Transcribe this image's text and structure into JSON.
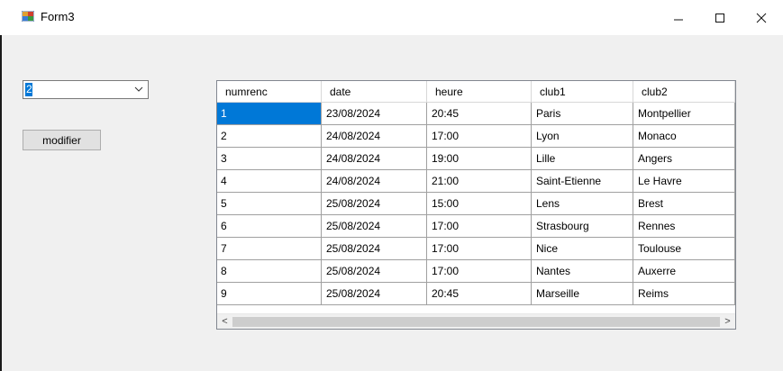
{
  "window": {
    "title": "Form3",
    "icon": "winforms-app-icon",
    "minimize_glyph": "—",
    "maximize_glyph": "☐",
    "close_glyph": "✕"
  },
  "combo": {
    "selected_value": "2",
    "arrow_icon": "chevron-down-icon"
  },
  "buttons": {
    "modifier_label": "modifier"
  },
  "grid": {
    "columns": [
      "numrenc",
      "date",
      "heure",
      "club1",
      "club2"
    ],
    "selected_row": 0,
    "rows": [
      [
        "1",
        "23/08/2024",
        "20:45",
        "Paris",
        "Montpellier"
      ],
      [
        "2",
        "24/08/2024",
        "17:00",
        "Lyon",
        "Monaco"
      ],
      [
        "3",
        "24/08/2024",
        "19:00",
        "Lille",
        "Angers"
      ],
      [
        "4",
        "24/08/2024",
        "21:00",
        "Saint-Etienne",
        "Le Havre"
      ],
      [
        "5",
        "25/08/2024",
        "15:00",
        "Lens",
        "Brest"
      ],
      [
        "6",
        "25/08/2024",
        "17:00",
        "Strasbourg",
        "Rennes"
      ],
      [
        "7",
        "25/08/2024",
        "17:00",
        "Nice",
        "Toulouse"
      ],
      [
        "8",
        "25/08/2024",
        "17:00",
        "Nantes",
        "Auxerre"
      ],
      [
        "9",
        "25/08/2024",
        "20:45",
        "Marseille",
        "Reims"
      ]
    ]
  },
  "scrollbar": {
    "left_glyph": "<",
    "right_glyph": ">"
  },
  "colors": {
    "selection": "#0078d7",
    "window_bg": "#f0f0f0"
  }
}
